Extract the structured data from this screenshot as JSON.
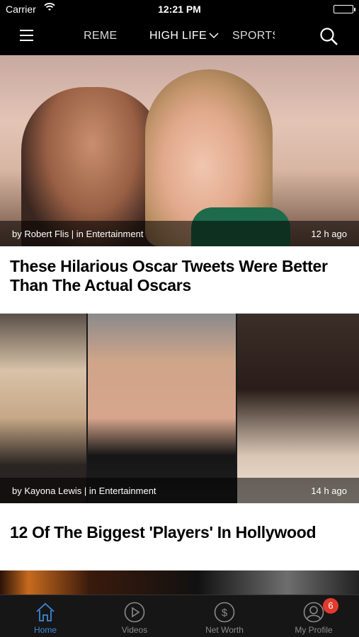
{
  "status_bar": {
    "carrier": "Carrier",
    "time": "12:21 PM"
  },
  "nav": {
    "menu_icon": "hamburger-menu-icon",
    "tabs": [
      {
        "label": "TREME"
      },
      {
        "label": "HIGH LIFE"
      },
      {
        "label": "SPORTS"
      }
    ],
    "search_icon": "search-icon"
  },
  "articles": [
    {
      "byline": "by Robert Flis | in Entertainment",
      "time_ago": "12 h ago",
      "title": "These Hilarious Oscar Tweets Were Better Than The Actual Oscars"
    },
    {
      "byline": "by Kayona Lewis | in Entertainment",
      "time_ago": "14 h ago",
      "title": "12 Of The Biggest 'Players' In Hollywood"
    }
  ],
  "tab_bar": {
    "active_color": "#3d87d6",
    "inactive_color": "#8a8a8a",
    "tabs": [
      {
        "label": "Home",
        "icon": "home-icon"
      },
      {
        "label": "Videos",
        "icon": "play-icon"
      },
      {
        "label": "Net Worth",
        "icon": "dollar-icon"
      },
      {
        "label": "My Profile",
        "icon": "profile-icon",
        "badge": "6"
      }
    ]
  }
}
